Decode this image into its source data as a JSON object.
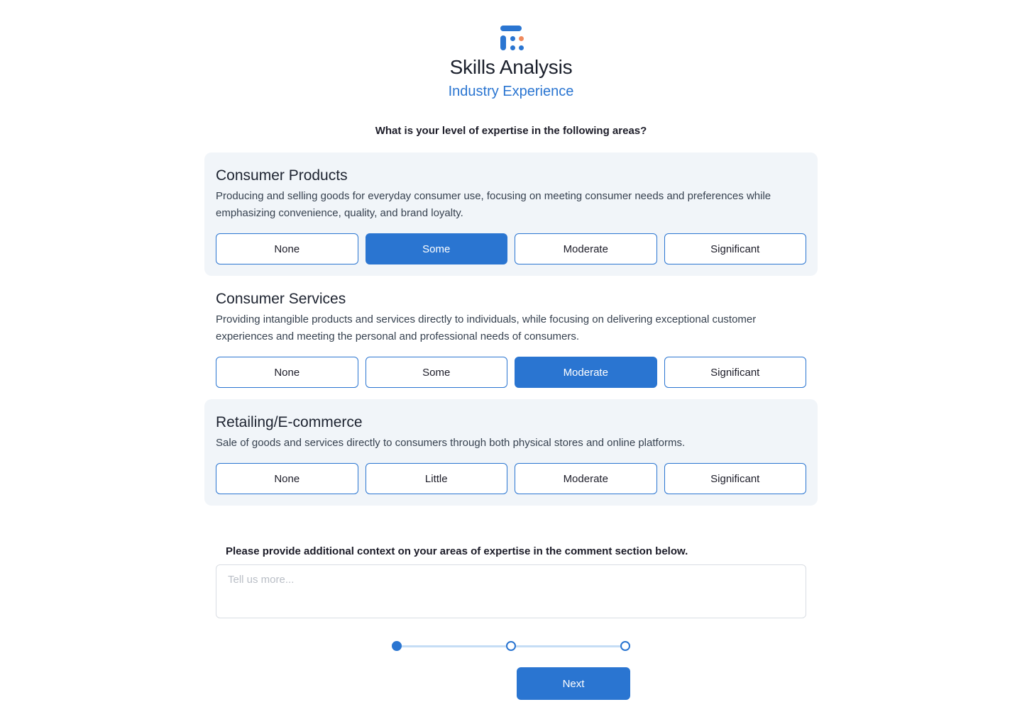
{
  "header": {
    "logo_name": "skills-analysis-logo",
    "title": "Skills Analysis",
    "subtitle": "Industry Experience",
    "accent_color": "#2a75d1",
    "logo_accent_color": "#f08a5d"
  },
  "question": "What is your level of expertise in the following areas?",
  "groups": [
    {
      "title": "Consumer Products",
      "description": "Producing and selling goods for everyday consumer use, focusing on meeting consumer needs and preferences while emphasizing convenience, quality, and brand loyalty.",
      "shaded": true,
      "options": [
        "None",
        "Some",
        "Moderate",
        "Significant"
      ],
      "selected": "Some"
    },
    {
      "title": "Consumer Services",
      "description": "Providing intangible products and services directly to individuals, while focusing on delivering exceptional customer experiences and meeting the personal and professional needs of consumers.",
      "shaded": false,
      "options": [
        "None",
        "Some",
        "Moderate",
        "Significant"
      ],
      "selected": "Moderate"
    },
    {
      "title": "Retailing/E-commerce",
      "description": "Sale of goods and services directly to consumers through both physical stores and online platforms.",
      "shaded": true,
      "options": [
        "None",
        "Little",
        "Moderate",
        "Significant"
      ],
      "selected": null
    }
  ],
  "comment": {
    "label": "Please provide additional context on your areas of expertise in the comment section below.",
    "placeholder": "Tell us more...",
    "value": ""
  },
  "stepper": {
    "total": 3,
    "current": 1
  },
  "footer": {
    "next_label": "Next"
  }
}
